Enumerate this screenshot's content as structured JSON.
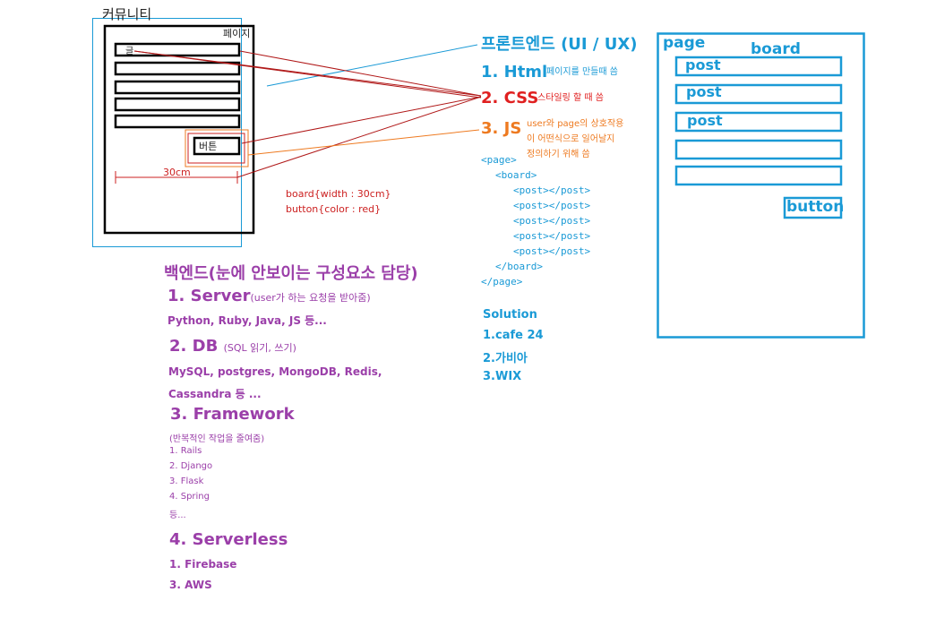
{
  "community": {
    "title": "커뮤니티",
    "page_label": "페이지",
    "post_label": "글",
    "button_label": "버튼",
    "width_label": "30cm"
  },
  "css_note": {
    "line1": "board{width : 30cm}",
    "line2": "button{color : red}"
  },
  "frontend": {
    "heading": "프론트엔드 (UI / UX)",
    "items": [
      {
        "title": "1. Html",
        "desc": "페이지를 만들때 씀",
        "color": "#1a9ad6"
      },
      {
        "title": "2. CSS",
        "desc": "스타일링 할 때 씀",
        "color": "#e02020"
      },
      {
        "title": "3. JS",
        "desc_lines": [
          "user와 page의 상호작용",
          "이 어떤식으로 일어날지",
          "정의하기 위해 씀"
        ],
        "color": "#ee7a20"
      }
    ],
    "code_lines": [
      "<page>",
      "<board>",
      "<post></post>",
      "<post></post>",
      "<post></post>",
      "<post></post>",
      "<post></post>",
      "</board>",
      "</page>"
    ],
    "solution": {
      "title": "Solution",
      "items": [
        "1.cafe 24",
        "2.가비아",
        "3.WIX"
      ]
    }
  },
  "mockup": {
    "page_label": "page",
    "board_label": "board",
    "posts": [
      "post",
      "post",
      "post",
      "",
      ""
    ],
    "button_label": "button"
  },
  "backend": {
    "heading": "백엔드(눈에 안보이는 구성요소 담당)",
    "server": {
      "title": "1. Server",
      "paren": "(user가 하는 요청을 받아줌)",
      "examples": "Python, Ruby, Java, JS 등..."
    },
    "db": {
      "title": "2. DB",
      "paren": "(SQL 읽기, 쓰기)",
      "examples_line1": "MySQL, postgres, MongoDB, Redis,",
      "examples_line2": "Cassandra 등 ..."
    },
    "framework": {
      "title": "3. Framework",
      "note": "(반복적인 작업을 줄여줌)",
      "items": [
        "1. Rails",
        "2. Django",
        "3. Flask",
        "4. Spring",
        "등..."
      ]
    },
    "serverless": {
      "title": "4. Serverless",
      "items": [
        "1. Firebase",
        "3. AWS"
      ]
    }
  },
  "colors": {
    "blue": "#1a9ad6",
    "red": "#e02020",
    "orange": "#ee7a20",
    "purple": "#9b3fa9",
    "darkred": "#b01818"
  }
}
